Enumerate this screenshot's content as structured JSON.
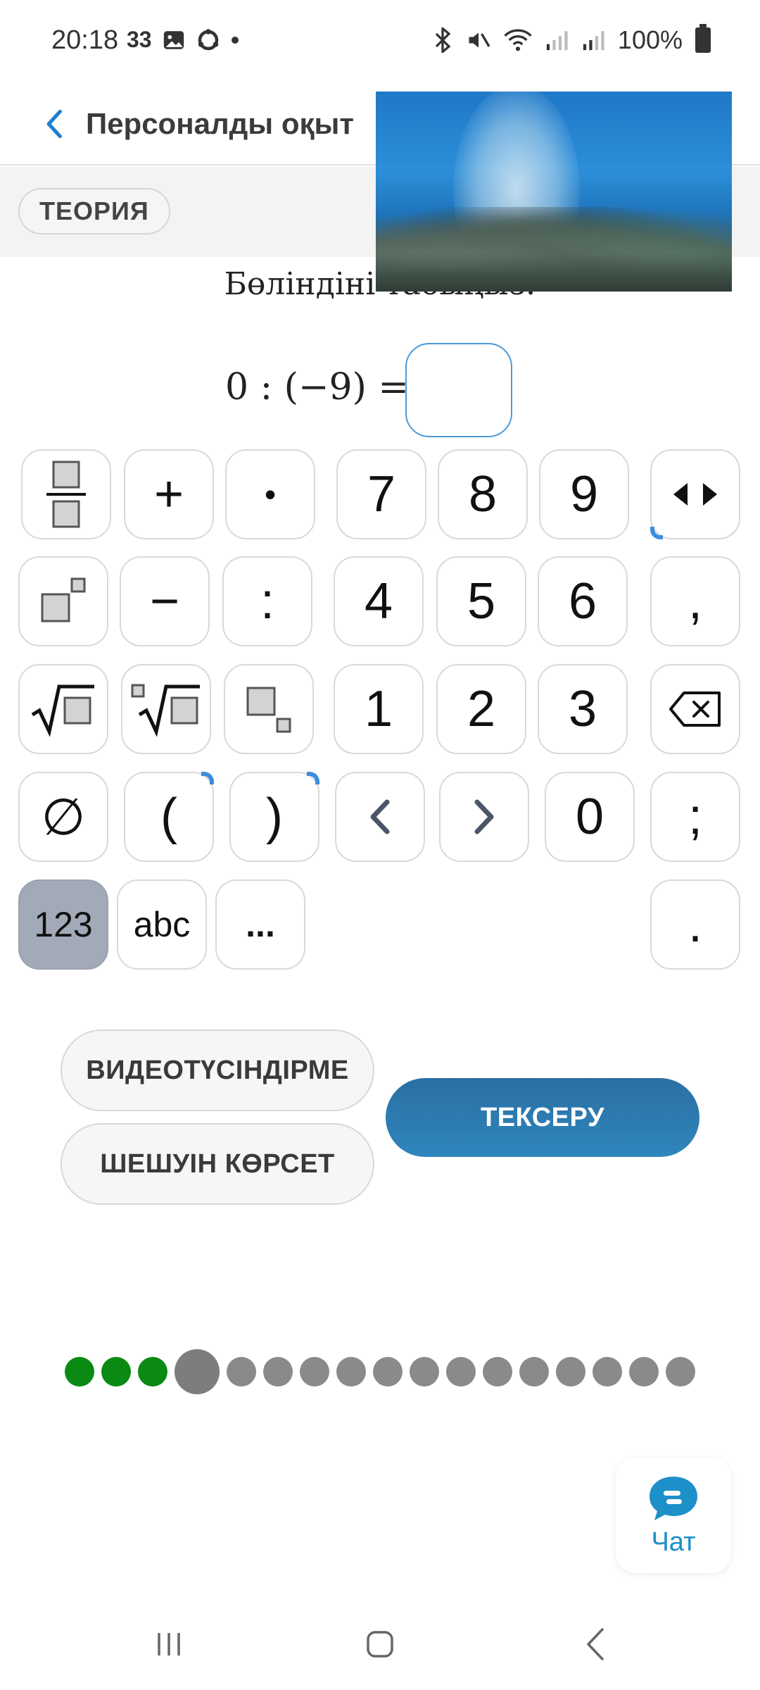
{
  "status_bar": {
    "time": "20:18",
    "notification_text": "33",
    "battery": "100%"
  },
  "header": {
    "title": "Персоналды оқыт"
  },
  "subbar": {
    "theory_label": "ТЕОРИЯ"
  },
  "question": {
    "prompt": "Бөліндіні табыңыз:",
    "equation": "0 : (−9) ="
  },
  "keyboard": {
    "digits": {
      "k7": "7",
      "k8": "8",
      "k9": "9",
      "k4": "4",
      "k5": "5",
      "k6": "6",
      "k1": "1",
      "k2": "2",
      "k3": "3",
      "k0": "0"
    },
    "symbols": {
      "plus": "+",
      "dot": "•",
      "minus": "−",
      "colon": ":",
      "comma": ",",
      "empty_set": "∅",
      "lparen": "(",
      "rparen": ")",
      "semicolon": ";",
      "period": "."
    },
    "modes": {
      "numeric": "123",
      "letters": "abc",
      "more": "..."
    },
    "active_mode": "123"
  },
  "actions": {
    "video_explain": "ВИДЕОТҮСІНДІРМЕ",
    "show_solution": "ШЕШУІН КӨРСЕТ",
    "check": "ТЕКСЕРУ"
  },
  "progress": {
    "total": 17,
    "completed": 3,
    "current_index": 4
  },
  "chat": {
    "label": "Чат"
  },
  "colors": {
    "accent_blue": "#2f86bd",
    "progress_done": "#0a8a12",
    "progress_pending": "#8a8a8a",
    "active_key": "#a3aab7"
  }
}
